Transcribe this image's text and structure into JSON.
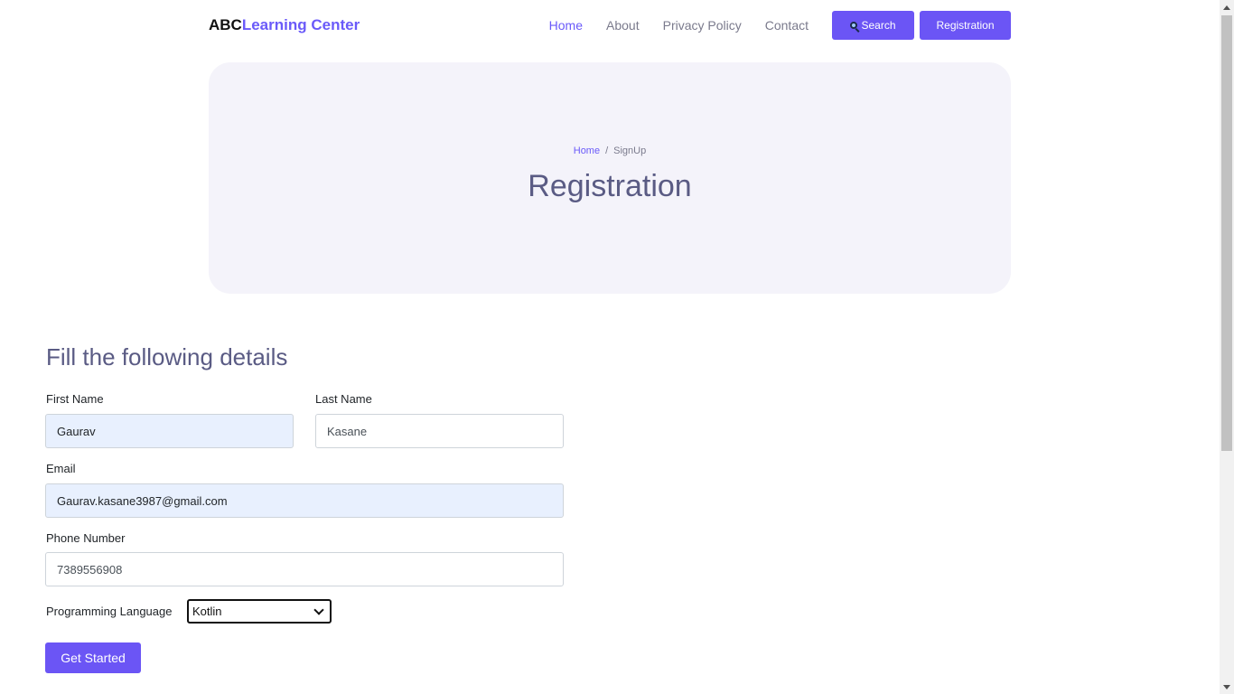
{
  "brand": {
    "part1": "ABC",
    "part2": "Learning Center"
  },
  "nav": {
    "links": [
      "Home",
      "About",
      "Privacy Policy",
      "Contact"
    ],
    "search_label": "Search",
    "registration_label": "Registration"
  },
  "hero": {
    "breadcrumb_home": "Home",
    "breadcrumb_sep": "/",
    "breadcrumb_current": "SignUp",
    "title": "Registration"
  },
  "form": {
    "title": "Fill the following details",
    "first_name_label": "First Name",
    "first_name_value": "Gaurav",
    "last_name_label": "Last Name",
    "last_name_value": "Kasane",
    "email_label": "Email",
    "email_value": "Gaurav.kasane3987@gmail.com",
    "phone_label": "Phone Number",
    "phone_value": "7389556908",
    "language_label": "Programming Language",
    "language_value": "Kotlin",
    "submit_label": "Get Started"
  },
  "colors": {
    "accent": "#6b55f5",
    "heading": "#5a5b84",
    "hero_bg": "#f4f3fa",
    "autofill_bg": "#e8f0fe"
  },
  "icons": {
    "search": "magnifier-icon"
  }
}
